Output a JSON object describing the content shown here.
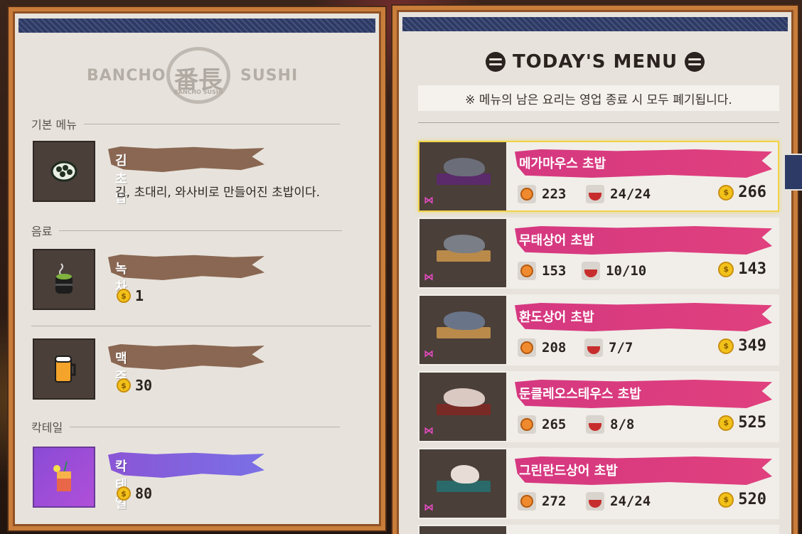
{
  "left_panel": {
    "logo": {
      "left_word": "BANCHO",
      "right_word": "SUSHI",
      "kanji": "番長",
      "sub": "BANCHO SUSHI"
    },
    "sections": [
      {
        "title": "기본 메뉴"
      },
      {
        "title": "음료"
      },
      {
        "title": "칵테일"
      }
    ],
    "items": [
      {
        "name": "김 초밥",
        "desc": "김, 초대리, 와사비로 만들어진 초밥이다.",
        "icon": "gimbap-icon"
      },
      {
        "name": "녹차",
        "price": "1",
        "icon": "green-tea-icon"
      },
      {
        "name": "맥주",
        "price": "30",
        "icon": "beer-icon"
      },
      {
        "name": "칵테일",
        "price": "80",
        "icon": "cocktail-icon"
      }
    ]
  },
  "right_panel": {
    "title": "TODAY'S MENU",
    "notice": "※ 메뉴의 남은 요리는 영업 종료 시 모두 폐기됩니다.",
    "menu": [
      {
        "name": "메가마우스 초밥",
        "taste": "223",
        "stock": "24/24",
        "price": "266",
        "selected": true
      },
      {
        "name": "무태상어 초밥",
        "taste": "153",
        "stock": "10/10",
        "price": "143",
        "selected": false
      },
      {
        "name": "환도상어 초밥",
        "taste": "208",
        "stock": "7/7",
        "price": "349",
        "selected": false
      },
      {
        "name": "둔클레오스테우스 초밥",
        "taste": "265",
        "stock": "8/8",
        "price": "525",
        "selected": false
      },
      {
        "name": "그린란드상어 초밥",
        "taste": "272",
        "stock": "24/24",
        "price": "520",
        "selected": false
      }
    ]
  },
  "colors": {
    "panel": "#e7e3dc",
    "frame": "#c97d3a",
    "stripe": "#2d3a66",
    "pink": "#d53880",
    "brown_brush": "#8a6752",
    "coin": "#f2c21a"
  }
}
